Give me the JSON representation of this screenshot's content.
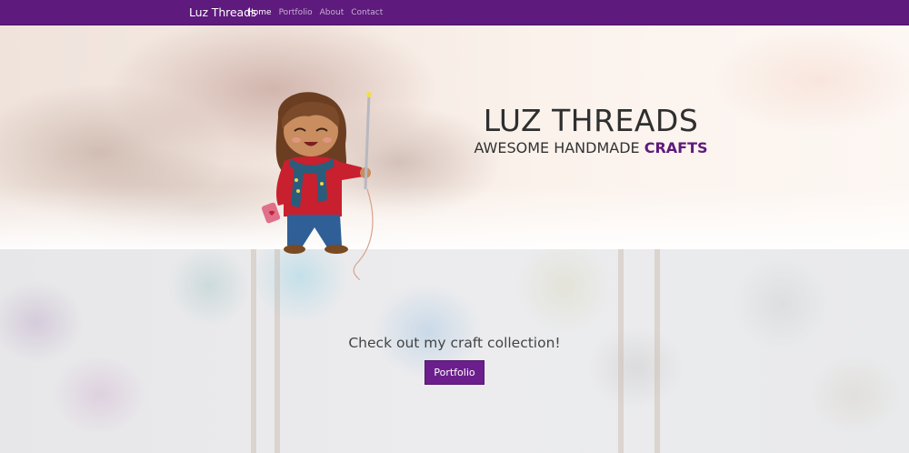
{
  "navbar": {
    "brand": "Luz Threads",
    "links": [
      {
        "label": "Home",
        "active": true
      },
      {
        "label": "Portfolio",
        "active": false
      },
      {
        "label": "About",
        "active": false
      },
      {
        "label": "Contact",
        "active": false
      }
    ]
  },
  "hero": {
    "title": "LUZ THREADS",
    "subtitle_prefix": "AWESOME HANDMADE ",
    "subtitle_accent": "CRAFTS"
  },
  "cta": {
    "text": "Check out my craft collection!",
    "button_label": "Portfolio"
  },
  "colors": {
    "brand_purple": "#5e1a7c",
    "button_purple": "#6c1f8c"
  }
}
